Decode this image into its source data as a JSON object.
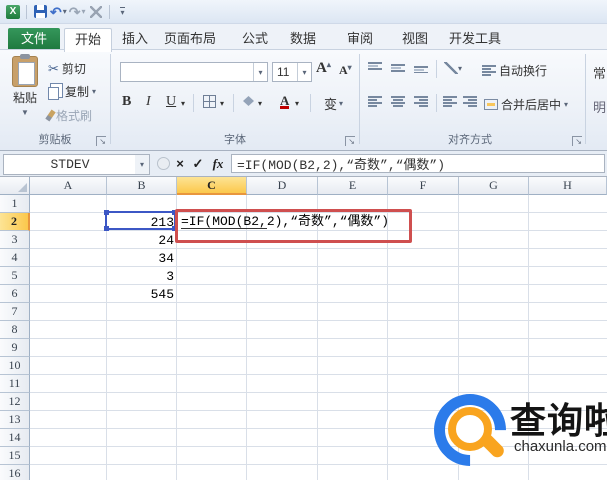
{
  "titlebar": {
    "excel_logo_glyph": "X",
    "undo_glyph": "↶",
    "redo_glyph": "↷",
    "qat_more_glyph": "▼"
  },
  "tabs": {
    "active": "开始",
    "items": [
      "文件",
      "开始",
      "插入",
      "页面布局",
      "公式",
      "数据",
      "审阅",
      "视图",
      "开发工具"
    ]
  },
  "ribbon": {
    "clipboard": {
      "title": "剪贴板",
      "paste": "粘贴",
      "cut": "剪切",
      "copy": "复制",
      "format_painter": "格式刷"
    },
    "font": {
      "title": "字体",
      "font_name_value": "",
      "font_size": "11",
      "bold": "B",
      "italic": "I",
      "underline": "U",
      "grow": "A",
      "shrink": "A",
      "font_color_letter": "A",
      "phonetic": "变"
    },
    "alignment": {
      "title": "对齐方式",
      "wrap_text": "自动换行",
      "merge_center": "合并后居中"
    },
    "number": {
      "partial_label": "常",
      "partial_label2": "明"
    }
  },
  "formula_bar": {
    "name_box": "STDEV",
    "cancel_glyph": "×",
    "enter_glyph": "✓",
    "insert_function": "fx",
    "formula": "=IF(MOD(B2,2),“奇数”,“偶数”)"
  },
  "grid": {
    "columns": [
      "A",
      "B",
      "C",
      "D",
      "E",
      "F",
      "G",
      "H"
    ],
    "rows": [
      "1",
      "2",
      "3",
      "4",
      "5",
      "6",
      "7",
      "8",
      "9",
      "10",
      "11",
      "12",
      "13",
      "14",
      "15",
      "16"
    ],
    "selected_column": "C",
    "selected_row": "2",
    "cells": [
      {
        "ref": "B2",
        "value": "213"
      },
      {
        "ref": "B3",
        "value": "24"
      },
      {
        "ref": "B4",
        "value": "34"
      },
      {
        "ref": "B5",
        "value": "3"
      },
      {
        "ref": "B6",
        "value": "545"
      }
    ],
    "edit_cell": {
      "ref": "C2",
      "text": "=IF(MOD(B2,2),“奇数”,“偶数”)"
    }
  },
  "watermark": {
    "name": "查询啦",
    "domain": "chaxunla.com"
  },
  "colors": {
    "file_tab_green": "#1f7a40",
    "selection_blue": "#3c57c5",
    "annotation_red": "#cf4f4f",
    "header_highlight": "#fbd564",
    "logo_blue": "#2b7bea",
    "logo_orange": "#f9a41f",
    "gridline": "#d9dfe8"
  }
}
